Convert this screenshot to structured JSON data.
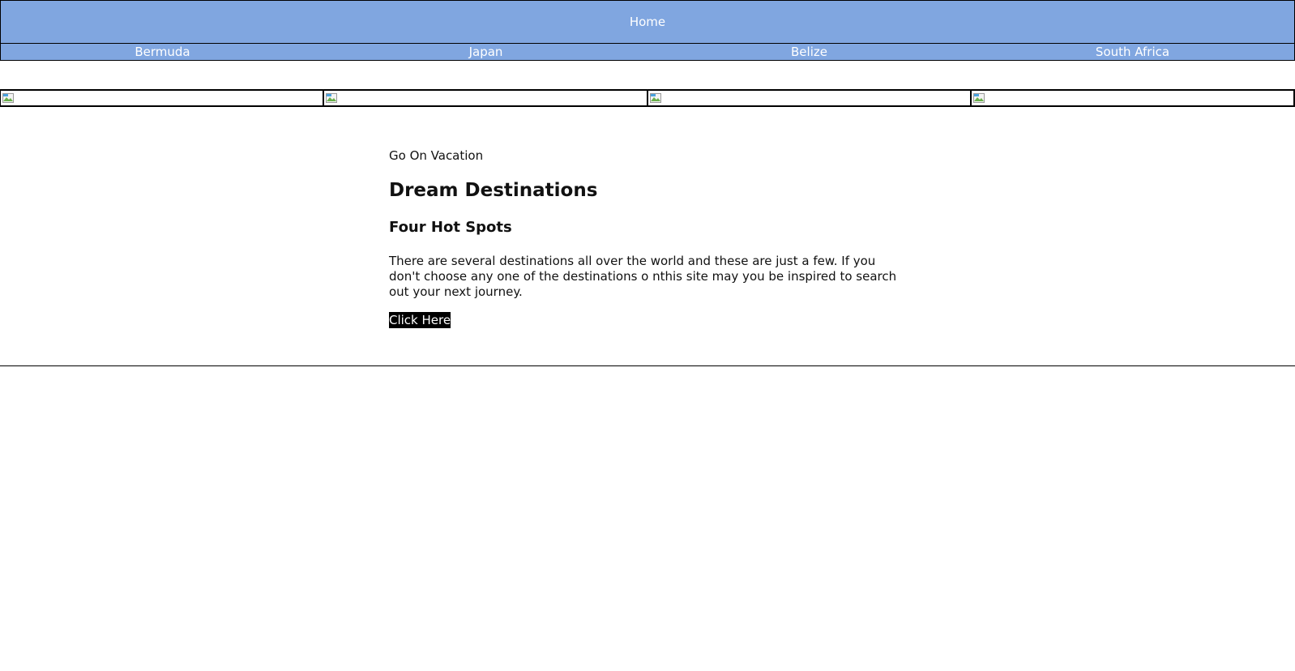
{
  "header": {
    "home_label": "Home"
  },
  "destinations_nav": [
    {
      "label": "Bermuda"
    },
    {
      "label": "Japan"
    },
    {
      "label": "Belize"
    },
    {
      "label": "South Africa"
    }
  ],
  "gallery": {
    "image_count": 4,
    "icon": "broken-image-icon"
  },
  "main": {
    "eyebrow": "Go On Vacation",
    "title": "Dream Destinations",
    "subtitle": "Four Hot Spots",
    "body": "There are several destinations all over the world and these are just a few. If you don't choose any one of the destinations o nthis site may you be inspired to search out your next journey.",
    "cta_label": "Click Here"
  },
  "colors": {
    "nav_background": "#80a6e0",
    "nav_text": "#ffffff",
    "cta_background": "#000000",
    "cta_text": "#ffffff"
  }
}
